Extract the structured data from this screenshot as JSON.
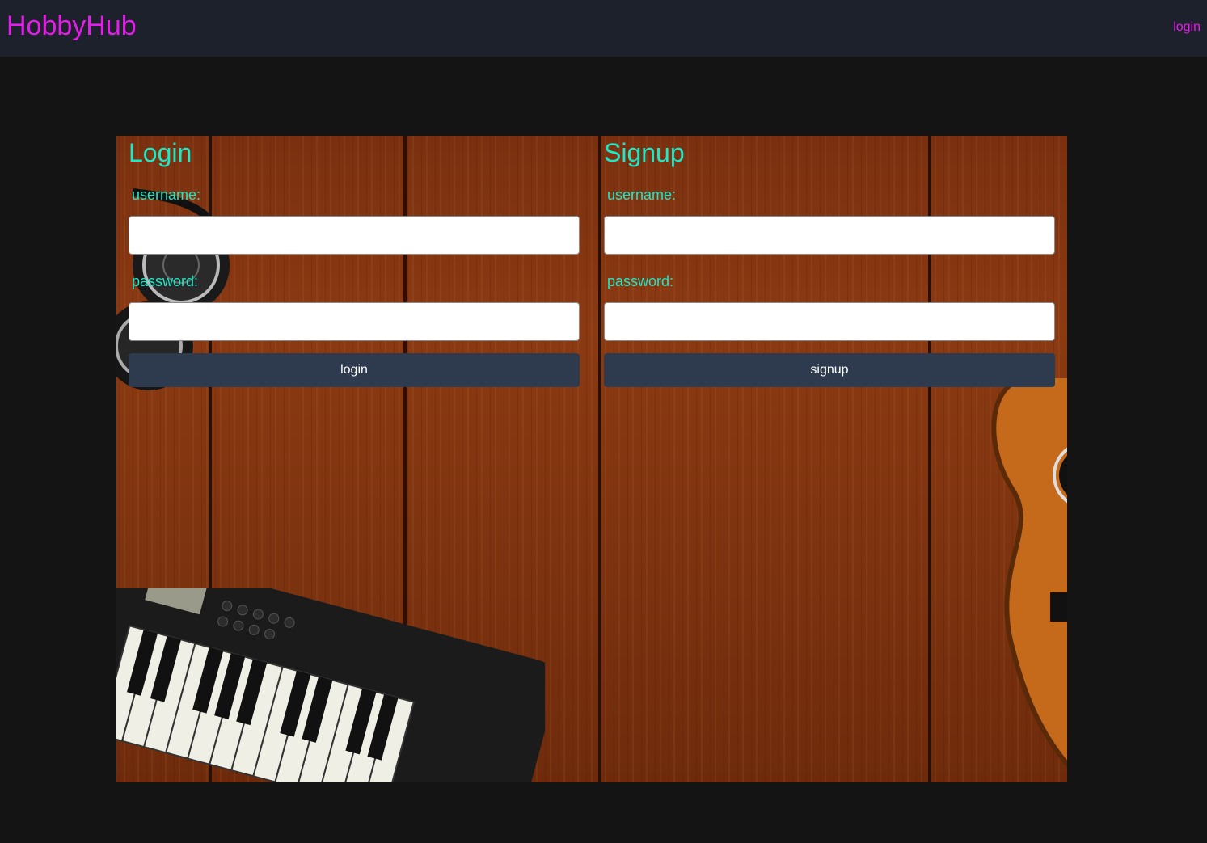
{
  "navbar": {
    "brand": "HobbyHub",
    "login_link": "login"
  },
  "login_form": {
    "heading": "Login",
    "username_label": "username:",
    "password_label": "password:",
    "username_value": "",
    "password_value": "",
    "submit_label": "login"
  },
  "signup_form": {
    "heading": "Signup",
    "username_label": "username:",
    "password_label": "password:",
    "username_value": "",
    "password_value": "",
    "submit_label": "signup"
  },
  "colors": {
    "brand": "#e31ee8",
    "heading": "#1de9c7",
    "navbar_bg": "#1c212b",
    "page_bg": "#141414",
    "button_bg": "#2e3b4f"
  }
}
